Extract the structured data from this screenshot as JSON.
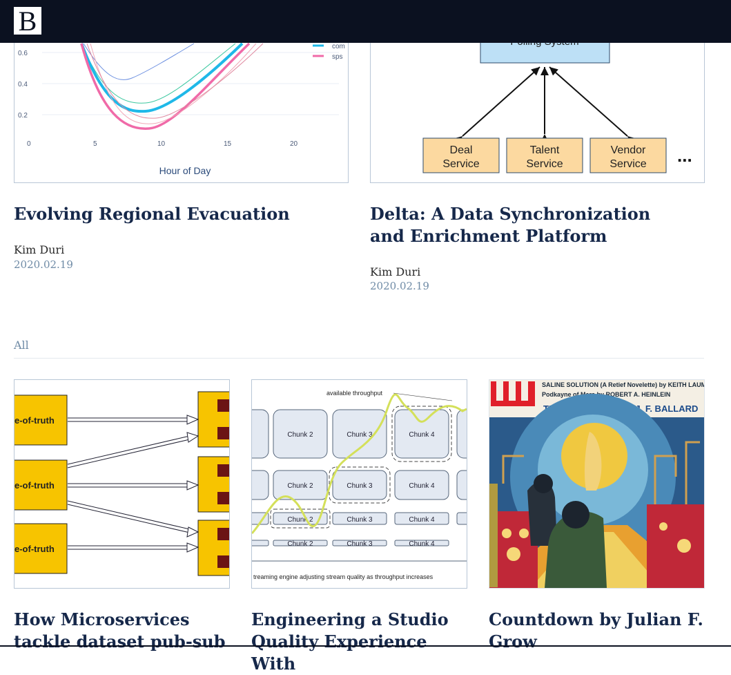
{
  "brand": {
    "logo_letter": "B"
  },
  "featured": [
    {
      "title": "Evolving Regional Evacuation",
      "author": "Kim Duri",
      "date": "2020.02.19",
      "chart": {
        "xlabel": "Hour of Day",
        "x_ticks": [
          "0",
          "5",
          "10",
          "15",
          "20"
        ],
        "y_ticks": [
          "0.6",
          "0.4",
          "0.2"
        ],
        "legend": [
          "com",
          "sps"
        ]
      }
    },
    {
      "title": "Delta: A Data Synchronization and Enrichment Platform",
      "author": "Kim Duri",
      "date": "2020.02.19",
      "diagram": {
        "top_box": "Polling System",
        "boxes": [
          {
            "line1": "Deal",
            "line2": "Service"
          },
          {
            "line1": "Talent",
            "line2": "Service"
          },
          {
            "line1": "Vendor",
            "line2": "Service"
          }
        ],
        "ellipsis": "..."
      }
    }
  ],
  "section": {
    "label": "All"
  },
  "posts": [
    {
      "title": "How Microservices tackle dataset pub-sub",
      "thumb": {
        "label": "e-of-truth"
      }
    },
    {
      "title": "Engineering a Studio Quality Experience With",
      "thumb": {
        "annotation": "available throughput",
        "chunks": [
          "Chunk 2",
          "Chunk 3",
          "Chunk 4"
        ],
        "caption": "treaming engine adjusting stream quality as throughput increases"
      }
    },
    {
      "title": "Countdown by Julian F. Grow",
      "thumb": {
        "line1": "SALINE SOLUTION (A Retief Novelette) by KEITH LAUMER",
        "line2": "Podkayne of Mars by ROBERT A. HEINLEIN",
        "line3": "THE TIME TOMBS by J. F. BALLARD"
      }
    }
  ]
}
